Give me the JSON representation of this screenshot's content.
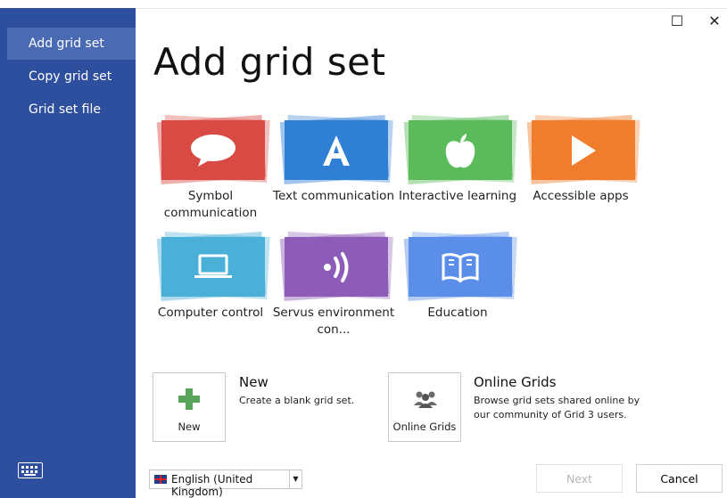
{
  "sidebar": {
    "items": [
      {
        "label": "Add grid set",
        "active": true
      },
      {
        "label": "Copy grid set",
        "active": false
      },
      {
        "label": "Grid set file",
        "active": false
      }
    ],
    "keyboard_icon": "keyboard-icon"
  },
  "window_controls": {
    "maximize": "☐",
    "close": "✕"
  },
  "main": {
    "title": "Add grid set",
    "tiles": [
      {
        "label": "Symbol communication",
        "color": "#d94a44",
        "icon": "speech-bubble-icon"
      },
      {
        "label": "Text communication",
        "color": "#2f7fd4",
        "icon": "letter-a-icon"
      },
      {
        "label": "Interactive learning",
        "color": "#5bbb5b",
        "icon": "apple-icon"
      },
      {
        "label": "Accessible apps",
        "color": "#f07d2d",
        "icon": "play-icon"
      },
      {
        "label": "Computer control",
        "color": "#4bb0d8",
        "icon": "laptop-icon"
      },
      {
        "label": "Servus environment con...",
        "color": "#8d5bb8",
        "icon": "signal-icon"
      },
      {
        "label": "Education",
        "color": "#5b8ee8",
        "icon": "book-icon"
      }
    ],
    "new_option": {
      "box_label": "New",
      "title": "New",
      "description": "Create a blank grid set.",
      "icon_color": "#5aa35a"
    },
    "online_option": {
      "box_label": "Online Grids",
      "title": "Online Grids",
      "description": "Browse grid sets shared online by our community of Grid 3 users."
    }
  },
  "footer": {
    "language": "English (United Kingdom)",
    "next_label": "Next",
    "cancel_label": "Cancel"
  }
}
